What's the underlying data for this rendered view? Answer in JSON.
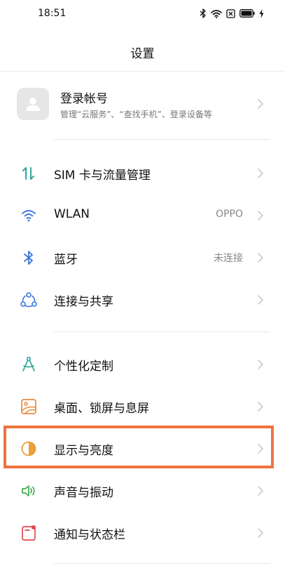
{
  "status_bar": {
    "time": "18:51",
    "icons": [
      "bluetooth-icon",
      "wifi-icon",
      "sim-off-icon",
      "battery-icon",
      "charging-icon"
    ]
  },
  "header": {
    "title": "设置"
  },
  "account": {
    "name": "登录帐号",
    "description": "管理“云服务”、“查找手机”、登录设备等",
    "icon": "person-icon"
  },
  "groups": [
    {
      "items": [
        {
          "label": "SIM 卡与流量管理",
          "value": "",
          "icon": "sim-data-icon",
          "color": "#2fa89a"
        },
        {
          "label": "WLAN",
          "value": "OPPO",
          "icon": "wifi-icon",
          "color": "#3a76d8"
        },
        {
          "label": "蓝牙",
          "value": "未连接",
          "icon": "bluetooth-icon",
          "color": "#3a76d8"
        },
        {
          "label": "连接与共享",
          "value": "",
          "icon": "share-nodes-icon",
          "color": "#3a76d8"
        }
      ]
    },
    {
      "items": [
        {
          "label": "个性化定制",
          "value": "",
          "icon": "compass-icon",
          "color": "#2fa89a"
        },
        {
          "label": "桌面、锁屏与息屏",
          "value": "",
          "icon": "wallpaper-icon",
          "color": "#e98a3a"
        },
        {
          "label": "显示与亮度",
          "value": "",
          "icon": "brightness-icon",
          "color": "#e9a03a"
        },
        {
          "label": "声音与振动",
          "value": "",
          "icon": "speaker-icon",
          "color": "#3fae4f"
        },
        {
          "label": "通知与状态栏",
          "value": "",
          "icon": "notification-icon",
          "color": "#e0484e"
        }
      ]
    }
  ],
  "highlight": {
    "target": "显示与亮度",
    "color": "#ee7340"
  }
}
